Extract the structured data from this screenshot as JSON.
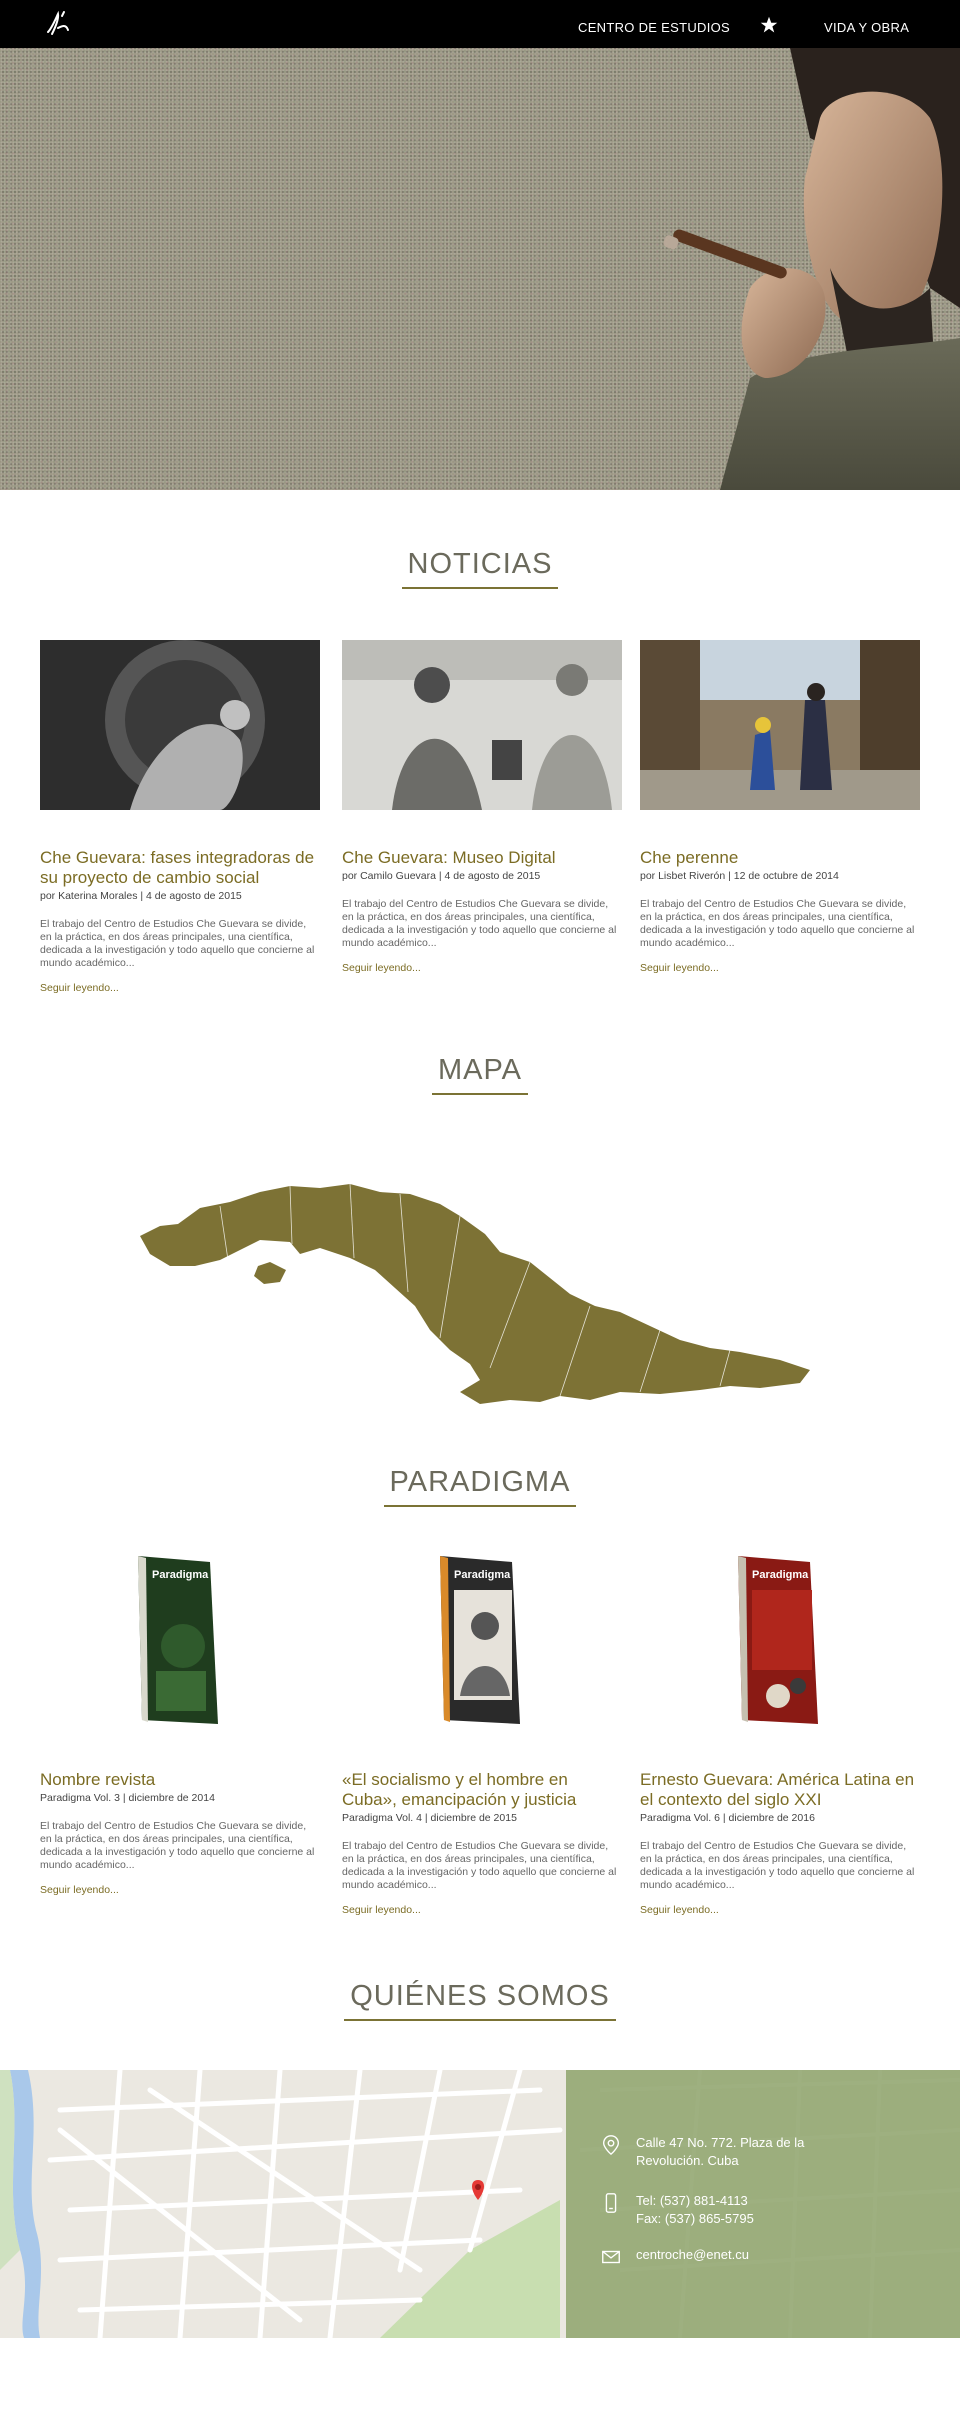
{
  "nav": {
    "logo": "logo-signature",
    "centro_label": "CENTRO DE ESTUDIOS",
    "vida_label": "VIDA Y OBRA",
    "star_icon": "star-icon"
  },
  "noticias": {
    "title": "NOTICIAS",
    "cards": [
      {
        "title": "Che Guevara: fases integradoras de su proyecto de cambio social",
        "meta": "por Katerina Morales | 4 de agosto de 2015",
        "text": "El trabajo del Centro de Estudios Che Guevara se divide, en la práctica, en dos áreas principales, una científica, dedicada a la investigación y todo aquello que concierne al mundo académico...",
        "more": "Seguir leyendo..."
      },
      {
        "title": "Che Guevara: Museo Digital",
        "meta": "por Camilo Guevara | 4 de agosto de 2015",
        "text": "El trabajo del Centro de Estudios Che Guevara se divide, en la práctica, en dos áreas principales, una científica, dedicada a la investigación y todo aquello que concierne al mundo académico...",
        "more": "Seguir leyendo..."
      },
      {
        "title": "Che perenne",
        "meta": "por Lisbet Riverón | 12 de octubre de 2014",
        "text": "El trabajo del Centro de Estudios Che Guevara se divide, en la práctica, en dos áreas principales, una científica, dedicada a la investigación y todo aquello que concierne al mundo académico...",
        "more": "Seguir leyendo..."
      }
    ]
  },
  "mapa": {
    "title": "MAPA",
    "color": "#7d7235"
  },
  "paradigma": {
    "title": "PARADIGMA",
    "cards": [
      {
        "title": "Nombre revista",
        "meta": "Paradigma Vol. 3 | diciembre de 2014",
        "text": "El trabajo del Centro de Estudios Che Guevara se divide, en la práctica, en dos áreas principales, una científica, dedicada a la investigación y todo aquello que concierne al mundo académico...",
        "more": "Seguir leyendo...",
        "cover": "Paradigma"
      },
      {
        "title": "«El socialismo y el hombre en Cuba», emancipación y justicia",
        "meta": "Paradigma Vol. 4 | diciembre de 2015",
        "text": "El trabajo del Centro de Estudios Che Guevara se divide, en la práctica, en dos áreas principales, una científica, dedicada a la investigación y todo aquello que concierne al mundo académico...",
        "more": "Seguir leyendo...",
        "cover": "Paradigma"
      },
      {
        "title": "Ernesto Guevara: América Latina en el contexto del siglo XXI",
        "meta": "Paradigma Vol. 6 | diciembre de 2016",
        "text": "El trabajo del Centro de Estudios Che Guevara se divide, en la práctica, en dos áreas principales, una científica, dedicada a la investigación y todo aquello que concierne al mundo académico...",
        "more": "Seguir leyendo...",
        "cover": "Paradigma"
      }
    ]
  },
  "quienes": {
    "title": "QUIÉNES SOMOS",
    "address": "Calle 47 No. 772. Plaza de la Revolución. Cuba",
    "phone": "Tel: (537) 881-4113",
    "fax": "Fax: (537) 865-5795",
    "email": "centroche@enet.cu"
  },
  "colors": {
    "accent": "#7b6c24",
    "nav": "#000000",
    "contact_panel": "#91a56e"
  }
}
